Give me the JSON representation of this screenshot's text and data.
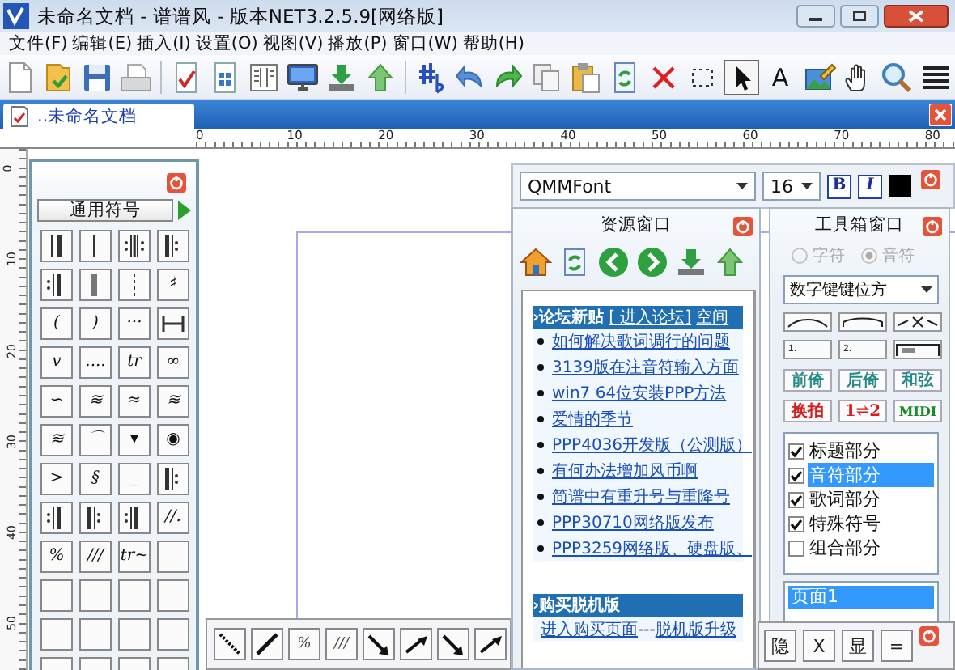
{
  "window": {
    "title": "未命名文档 - 谱谱风 - 版本NET3.2.5.9[网络版]"
  },
  "menu": [
    "文件(F)",
    "编辑(E)",
    "插入(I)",
    "设置(O)",
    "视图(V)",
    "播放(P)",
    "窗口(W)",
    "帮助(H)"
  ],
  "toolbar": {
    "groups": [
      [
        {
          "pressed": false
        },
        {
          "pressed": false
        },
        {
          "pressed": false
        },
        {
          "pressed": false
        }
      ],
      [
        {
          "pressed": false
        },
        {
          "pressed": false
        },
        {
          "pressed": false
        },
        {
          "pressed": false
        },
        {
          "pressed": false
        },
        {
          "pressed": false
        }
      ],
      [
        {
          "pressed": false
        },
        {
          "pressed": false
        },
        {
          "pressed": false
        },
        {
          "pressed": false
        },
        {
          "pressed": false
        },
        {
          "pressed": false
        },
        {
          "pressed": false
        },
        {
          "pressed": false
        },
        {
          "pressed": true
        },
        {
          "label": "A",
          "pressed": false
        },
        {
          "pressed": false
        },
        {
          "pressed": false
        },
        {
          "pressed": false
        },
        {
          "pressed": false
        }
      ]
    ]
  },
  "tabs": [
    {
      "label": "..未命名文档",
      "selected": true
    }
  ],
  "ruler": {
    "labels": [
      "0",
      "10",
      "20",
      "30",
      "40",
      "50",
      "60",
      "70",
      "80"
    ]
  },
  "vertical_ruler": {
    "labels": [
      "0",
      "10",
      "20",
      "30",
      "40",
      "50"
    ]
  },
  "symbol_panel": {
    "title": "通用符号",
    "cells": [
      {
        "kind": "bar-end"
      },
      {
        "kind": "bar-single"
      },
      {
        "kind": "repeat-both"
      },
      {
        "kind": "repeat-start"
      },
      {
        "kind": "repeat-end"
      },
      {
        "kind": "bar-thick"
      },
      {
        "kind": "bar-dashed"
      },
      {
        "kind": "text",
        "label": "♯"
      },
      {
        "kind": "text",
        "label": "("
      },
      {
        "kind": "text",
        "label": ")"
      },
      {
        "kind": "text",
        "label": "···"
      },
      {
        "kind": "bracket"
      },
      {
        "kind": "text",
        "label": "v"
      },
      {
        "kind": "text",
        "label": "...."
      },
      {
        "kind": "text",
        "label": "tr"
      },
      {
        "kind": "text",
        "label": "∞"
      },
      {
        "kind": "text",
        "label": "∽"
      },
      {
        "kind": "text",
        "label": "≋"
      },
      {
        "kind": "text",
        "label": "≈"
      },
      {
        "kind": "text",
        "label": "≋"
      },
      {
        "kind": "text",
        "label": "≋"
      },
      {
        "kind": "text",
        "label": "⌒"
      },
      {
        "kind": "text",
        "label": "▾"
      },
      {
        "kind": "text",
        "label": "◉"
      },
      {
        "kind": "text",
        "label": ">"
      },
      {
        "kind": "text",
        "label": "§"
      },
      {
        "kind": "text",
        "label": "_"
      },
      {
        "kind": "repeat-start"
      },
      {
        "kind": "repeat-end"
      },
      {
        "kind": "repeat-start"
      },
      {
        "kind": "repeat-end"
      },
      {
        "kind": "text",
        "label": "//."
      },
      {
        "kind": "text",
        "label": "%"
      },
      {
        "kind": "text",
        "label": "///"
      },
      {
        "kind": "text",
        "label": "tr~"
      },
      {
        "kind": "empty"
      },
      {
        "kind": "empty"
      },
      {
        "kind": "empty"
      },
      {
        "kind": "empty"
      },
      {
        "kind": "empty"
      },
      {
        "kind": "empty"
      },
      {
        "kind": "empty"
      },
      {
        "kind": "empty"
      },
      {
        "kind": "empty"
      },
      {
        "kind": "empty"
      },
      {
        "kind": "empty"
      },
      {
        "kind": "empty"
      },
      {
        "kind": "empty"
      }
    ]
  },
  "font_bar": {
    "font": "QMMFont",
    "size": "16",
    "bold": "B",
    "italic": "I",
    "color": "#000000"
  },
  "resource_window": {
    "title": "资源窗口",
    "forum": {
      "header": "›论坛新贴",
      "links": [
        "[ 进入论坛]",
        "空间"
      ],
      "items": [
        "如何解决歌词调行的问题",
        "3139版在注音符输入方面",
        "win7 64位安装PPP方法",
        "爱情的季节",
        "PPP4036开发版（公测版）",
        "有何办法增加风币啊",
        "简谱中有重升号与重降号",
        "PPP30710网络版发布",
        "PPP3259网络版、硬盘版、"
      ]
    },
    "buy": {
      "header": "›购买脱机版",
      "parts": [
        {
          "kind": "link",
          "text": "进入购买页面"
        },
        {
          "kind": "text",
          "text": "---"
        },
        {
          "kind": "link",
          "text": "脱机版升级"
        }
      ]
    }
  },
  "toolbox": {
    "title": "工具箱窗口",
    "radios": [
      {
        "label": "字符",
        "selected": false,
        "disabled": true
      },
      {
        "label": "音符",
        "selected": true,
        "disabled": true
      }
    ],
    "dropdown": "数字键键位方",
    "shape_buttons": [
      {
        "kind": "tie"
      },
      {
        "kind": "slur"
      },
      {
        "kind": "tuplet"
      }
    ],
    "volta_buttons": [
      {
        "kind": "volta",
        "label": "1."
      },
      {
        "kind": "volta",
        "label": "2."
      },
      {
        "kind": "volta-multi"
      }
    ],
    "buttons": [
      {
        "label": "前倚",
        "color": "#2a8a8a"
      },
      {
        "label": "后倚",
        "color": "#2a8a8a"
      },
      {
        "label": "和弦",
        "color": "#2a8a8a"
      },
      {
        "label": "换拍",
        "color": "#d42020"
      },
      {
        "label": "1⇌2",
        "color": "#d42020"
      },
      {
        "label": "MIDI",
        "color": "#1a8a2a"
      }
    ],
    "parts": [
      {
        "label": "标题部分",
        "checked": true,
        "selected": false
      },
      {
        "label": "音符部分",
        "checked": true,
        "selected": true
      },
      {
        "label": "歌词部分",
        "checked": true,
        "selected": false
      },
      {
        "label": "特殊符号",
        "checked": true,
        "selected": false
      },
      {
        "label": "组合部分",
        "checked": false,
        "selected": false
      }
    ],
    "pages": [
      {
        "label": "页面1",
        "selected": true
      }
    ]
  },
  "line_toolbar": {
    "buttons": [
      {
        "kind": "line-down"
      },
      {
        "kind": "line-up"
      },
      {
        "kind": "text",
        "label": "%"
      },
      {
        "kind": "text",
        "label": "///"
      },
      {
        "kind": "arrow-down"
      },
      {
        "kind": "arrow-up"
      },
      {
        "kind": "arrow-down"
      },
      {
        "kind": "arrow-up"
      }
    ]
  },
  "display_toolbar": {
    "buttons": [
      "隐",
      "X",
      "显",
      "="
    ]
  }
}
